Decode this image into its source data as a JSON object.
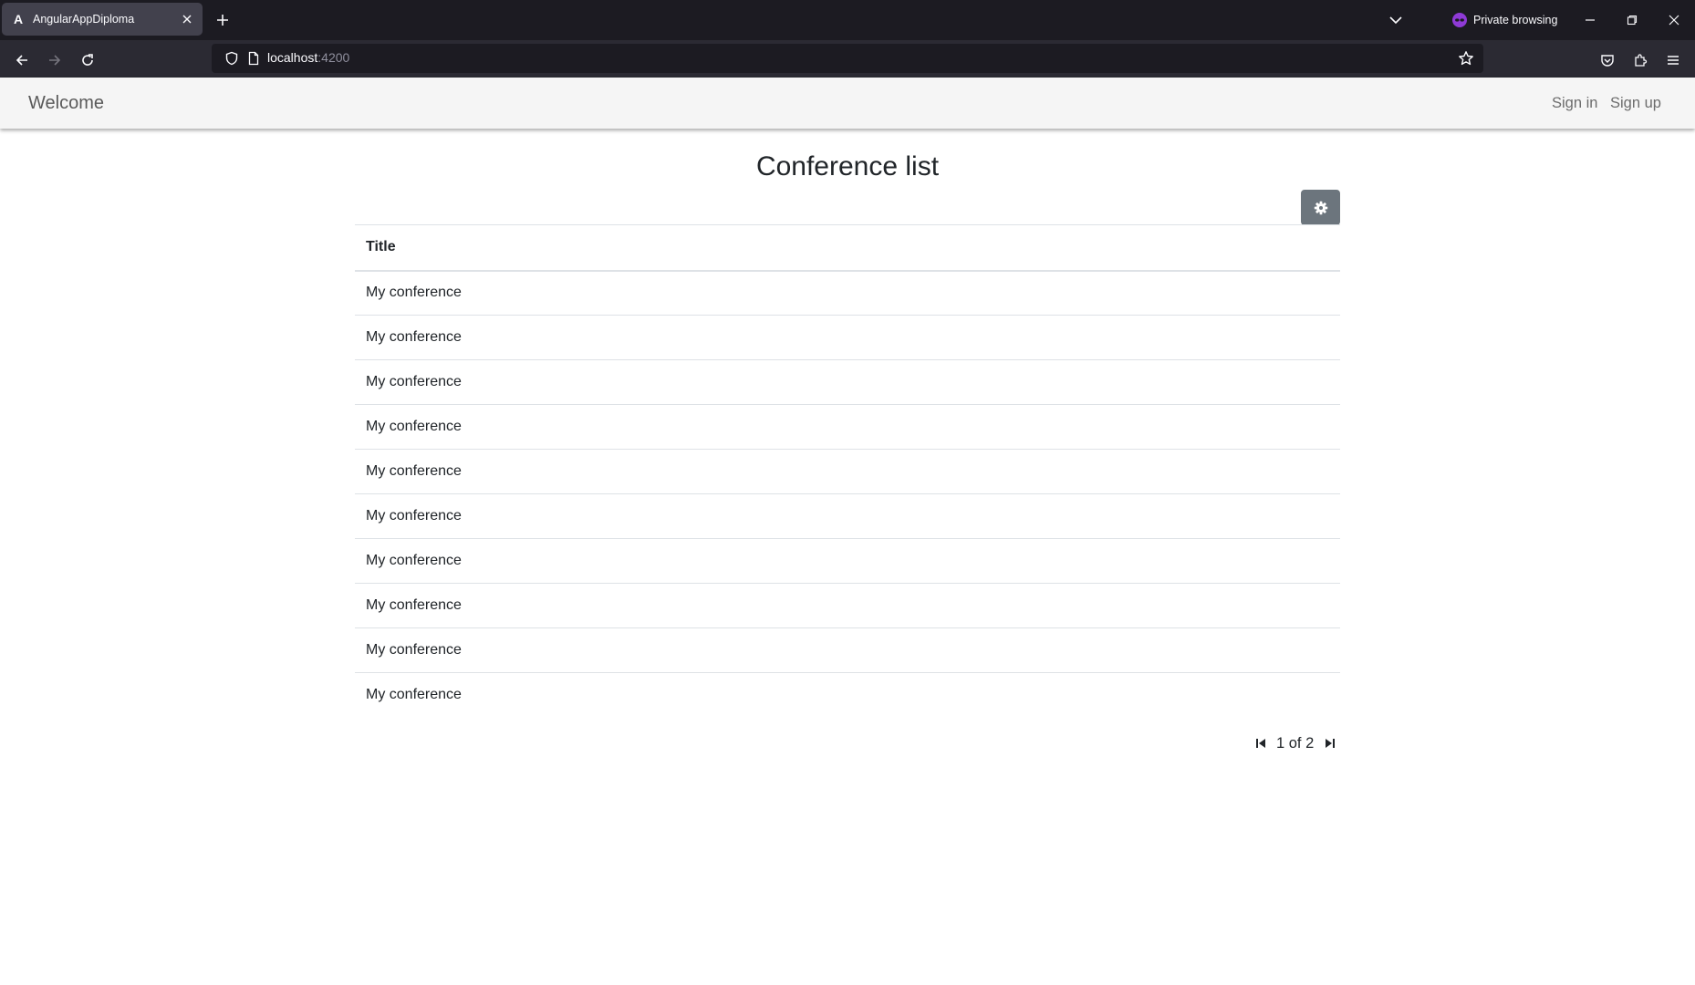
{
  "browser": {
    "tab": {
      "title": "AngularAppDiploma",
      "favicon_letter": "A"
    },
    "private_label": "Private browsing",
    "url": {
      "host": "localhost",
      "port": ":4200"
    },
    "icons": [
      "back-icon",
      "forward-icon",
      "reload-icon",
      "shield-icon",
      "page-icon",
      "bookmark-star-icon",
      "pocket-icon",
      "extensions-icon",
      "menu-icon",
      "new-tab-icon",
      "tab-list-icon",
      "private-mask-icon",
      "minimize-icon",
      "restore-icon",
      "close-icon"
    ]
  },
  "appbar": {
    "brand": "Welcome",
    "sign_in": "Sign in",
    "sign_up": "Sign up"
  },
  "main": {
    "title": "Conference list",
    "settings_icon": "gear-icon",
    "table": {
      "header": "Title",
      "rows": [
        "My conference",
        "My conference",
        "My conference",
        "My conference",
        "My conference",
        "My conference",
        "My conference",
        "My conference",
        "My conference",
        "My conference"
      ]
    },
    "pager": {
      "text": "1 of 2",
      "current_page": 1,
      "total_pages": 2
    }
  },
  "colors": {
    "chrome_dark": "#1c1b22",
    "toolbar": "#2b2a33",
    "appbar_bg": "#f5f5f5",
    "button_secondary": "#6c757d",
    "text": "#212529",
    "border": "#dee2e6"
  }
}
